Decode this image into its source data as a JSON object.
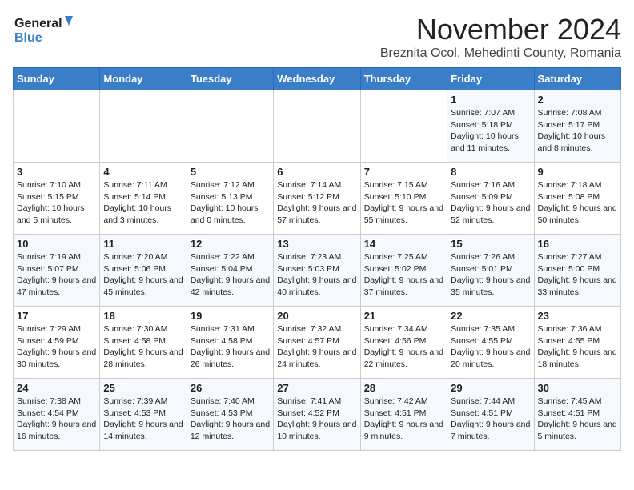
{
  "header": {
    "logo_line1": "General",
    "logo_line2": "Blue",
    "month": "November 2024",
    "location": "Breznita Ocol, Mehedinti County, Romania"
  },
  "days_of_week": [
    "Sunday",
    "Monday",
    "Tuesday",
    "Wednesday",
    "Thursday",
    "Friday",
    "Saturday"
  ],
  "weeks": [
    [
      {
        "day": "",
        "info": ""
      },
      {
        "day": "",
        "info": ""
      },
      {
        "day": "",
        "info": ""
      },
      {
        "day": "",
        "info": ""
      },
      {
        "day": "",
        "info": ""
      },
      {
        "day": "1",
        "info": "Sunrise: 7:07 AM\nSunset: 5:18 PM\nDaylight: 10 hours\nand 11 minutes."
      },
      {
        "day": "2",
        "info": "Sunrise: 7:08 AM\nSunset: 5:17 PM\nDaylight: 10 hours\nand 8 minutes."
      }
    ],
    [
      {
        "day": "3",
        "info": "Sunrise: 7:10 AM\nSunset: 5:15 PM\nDaylight: 10 hours\nand 5 minutes."
      },
      {
        "day": "4",
        "info": "Sunrise: 7:11 AM\nSunset: 5:14 PM\nDaylight: 10 hours\nand 3 minutes."
      },
      {
        "day": "5",
        "info": "Sunrise: 7:12 AM\nSunset: 5:13 PM\nDaylight: 10 hours\nand 0 minutes."
      },
      {
        "day": "6",
        "info": "Sunrise: 7:14 AM\nSunset: 5:12 PM\nDaylight: 9 hours\nand 57 minutes."
      },
      {
        "day": "7",
        "info": "Sunrise: 7:15 AM\nSunset: 5:10 PM\nDaylight: 9 hours\nand 55 minutes."
      },
      {
        "day": "8",
        "info": "Sunrise: 7:16 AM\nSunset: 5:09 PM\nDaylight: 9 hours\nand 52 minutes."
      },
      {
        "day": "9",
        "info": "Sunrise: 7:18 AM\nSunset: 5:08 PM\nDaylight: 9 hours\nand 50 minutes."
      }
    ],
    [
      {
        "day": "10",
        "info": "Sunrise: 7:19 AM\nSunset: 5:07 PM\nDaylight: 9 hours\nand 47 minutes."
      },
      {
        "day": "11",
        "info": "Sunrise: 7:20 AM\nSunset: 5:06 PM\nDaylight: 9 hours\nand 45 minutes."
      },
      {
        "day": "12",
        "info": "Sunrise: 7:22 AM\nSunset: 5:04 PM\nDaylight: 9 hours\nand 42 minutes."
      },
      {
        "day": "13",
        "info": "Sunrise: 7:23 AM\nSunset: 5:03 PM\nDaylight: 9 hours\nand 40 minutes."
      },
      {
        "day": "14",
        "info": "Sunrise: 7:25 AM\nSunset: 5:02 PM\nDaylight: 9 hours\nand 37 minutes."
      },
      {
        "day": "15",
        "info": "Sunrise: 7:26 AM\nSunset: 5:01 PM\nDaylight: 9 hours\nand 35 minutes."
      },
      {
        "day": "16",
        "info": "Sunrise: 7:27 AM\nSunset: 5:00 PM\nDaylight: 9 hours\nand 33 minutes."
      }
    ],
    [
      {
        "day": "17",
        "info": "Sunrise: 7:29 AM\nSunset: 4:59 PM\nDaylight: 9 hours\nand 30 minutes."
      },
      {
        "day": "18",
        "info": "Sunrise: 7:30 AM\nSunset: 4:58 PM\nDaylight: 9 hours\nand 28 minutes."
      },
      {
        "day": "19",
        "info": "Sunrise: 7:31 AM\nSunset: 4:58 PM\nDaylight: 9 hours\nand 26 minutes."
      },
      {
        "day": "20",
        "info": "Sunrise: 7:32 AM\nSunset: 4:57 PM\nDaylight: 9 hours\nand 24 minutes."
      },
      {
        "day": "21",
        "info": "Sunrise: 7:34 AM\nSunset: 4:56 PM\nDaylight: 9 hours\nand 22 minutes."
      },
      {
        "day": "22",
        "info": "Sunrise: 7:35 AM\nSunset: 4:55 PM\nDaylight: 9 hours\nand 20 minutes."
      },
      {
        "day": "23",
        "info": "Sunrise: 7:36 AM\nSunset: 4:55 PM\nDaylight: 9 hours\nand 18 minutes."
      }
    ],
    [
      {
        "day": "24",
        "info": "Sunrise: 7:38 AM\nSunset: 4:54 PM\nDaylight: 9 hours\nand 16 minutes."
      },
      {
        "day": "25",
        "info": "Sunrise: 7:39 AM\nSunset: 4:53 PM\nDaylight: 9 hours\nand 14 minutes."
      },
      {
        "day": "26",
        "info": "Sunrise: 7:40 AM\nSunset: 4:53 PM\nDaylight: 9 hours\nand 12 minutes."
      },
      {
        "day": "27",
        "info": "Sunrise: 7:41 AM\nSunset: 4:52 PM\nDaylight: 9 hours\nand 10 minutes."
      },
      {
        "day": "28",
        "info": "Sunrise: 7:42 AM\nSunset: 4:51 PM\nDaylight: 9 hours\nand 9 minutes."
      },
      {
        "day": "29",
        "info": "Sunrise: 7:44 AM\nSunset: 4:51 PM\nDaylight: 9 hours\nand 7 minutes."
      },
      {
        "day": "30",
        "info": "Sunrise: 7:45 AM\nSunset: 4:51 PM\nDaylight: 9 hours\nand 5 minutes."
      }
    ]
  ]
}
